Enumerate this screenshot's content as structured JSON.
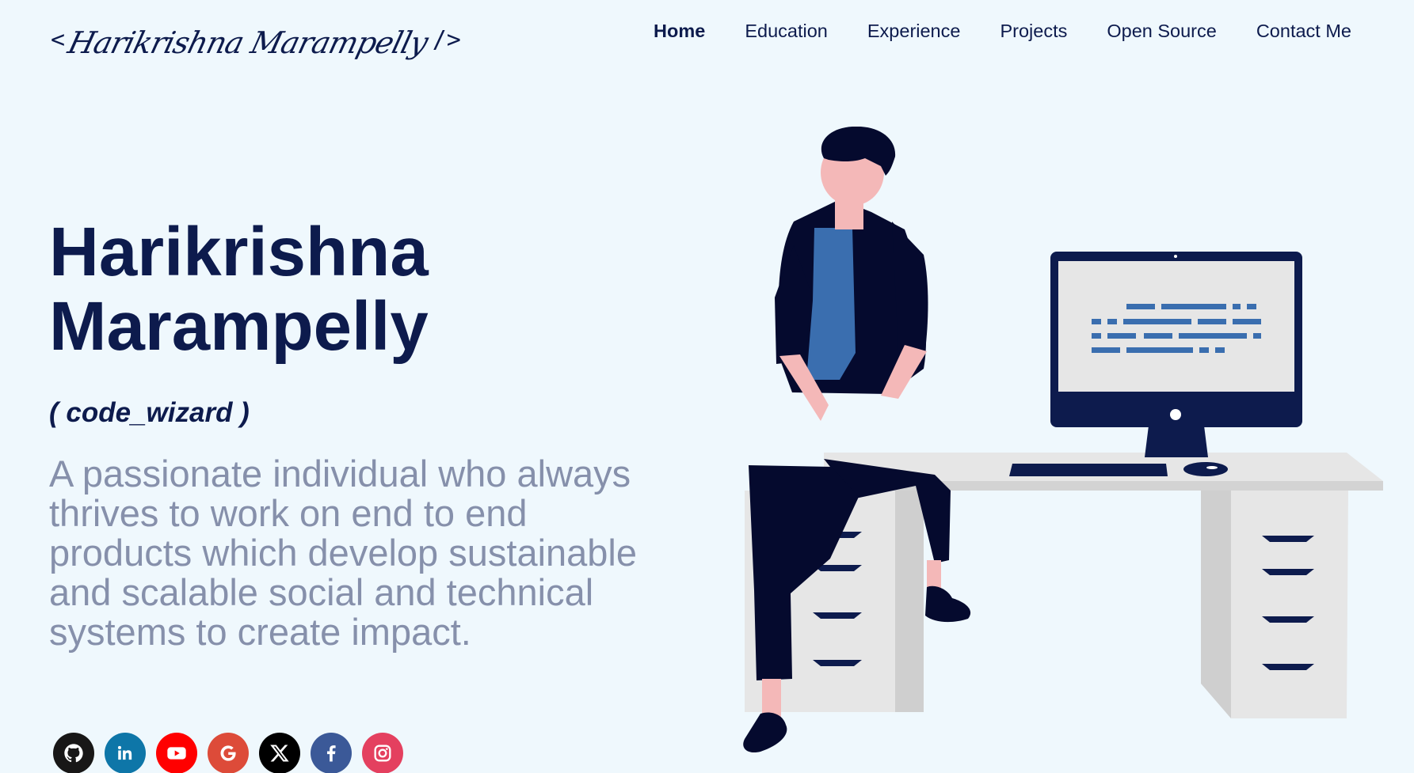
{
  "header": {
    "logo": {
      "open": "<",
      "signature": "Harikrishna Marampelly",
      "close": "/>"
    },
    "nav": [
      {
        "label": "Home",
        "active": true
      },
      {
        "label": "Education",
        "active": false
      },
      {
        "label": "Experience",
        "active": false
      },
      {
        "label": "Projects",
        "active": false
      },
      {
        "label": "Open Source",
        "active": false
      },
      {
        "label": "Contact Me",
        "active": false
      }
    ]
  },
  "hero": {
    "name": "Harikrishna Marampelly",
    "alias": "( code_wizard )",
    "description": "A passionate individual who always thrives to work on end to end products which develop sustainable and scalable social and technical systems to create impact."
  },
  "social": [
    {
      "icon": "github-icon",
      "color": "#181717"
    },
    {
      "icon": "linkedin-icon",
      "color": "#0e76a8"
    },
    {
      "icon": "youtube-icon",
      "color": "#ff0000"
    },
    {
      "icon": "google-icon",
      "color": "#dd4b39"
    },
    {
      "icon": "x-icon",
      "color": "#000000"
    },
    {
      "icon": "facebook-icon",
      "color": "#3b5998"
    },
    {
      "icon": "instagram-icon",
      "color": "#e4405f"
    }
  ],
  "colors": {
    "background": "#eff8fd",
    "primary": "#0d1b4d",
    "description_text": "#8690ab",
    "accent_blue": "#3a6eaf",
    "skin": "#f4b8b8",
    "desk": "#e6e6e6"
  }
}
